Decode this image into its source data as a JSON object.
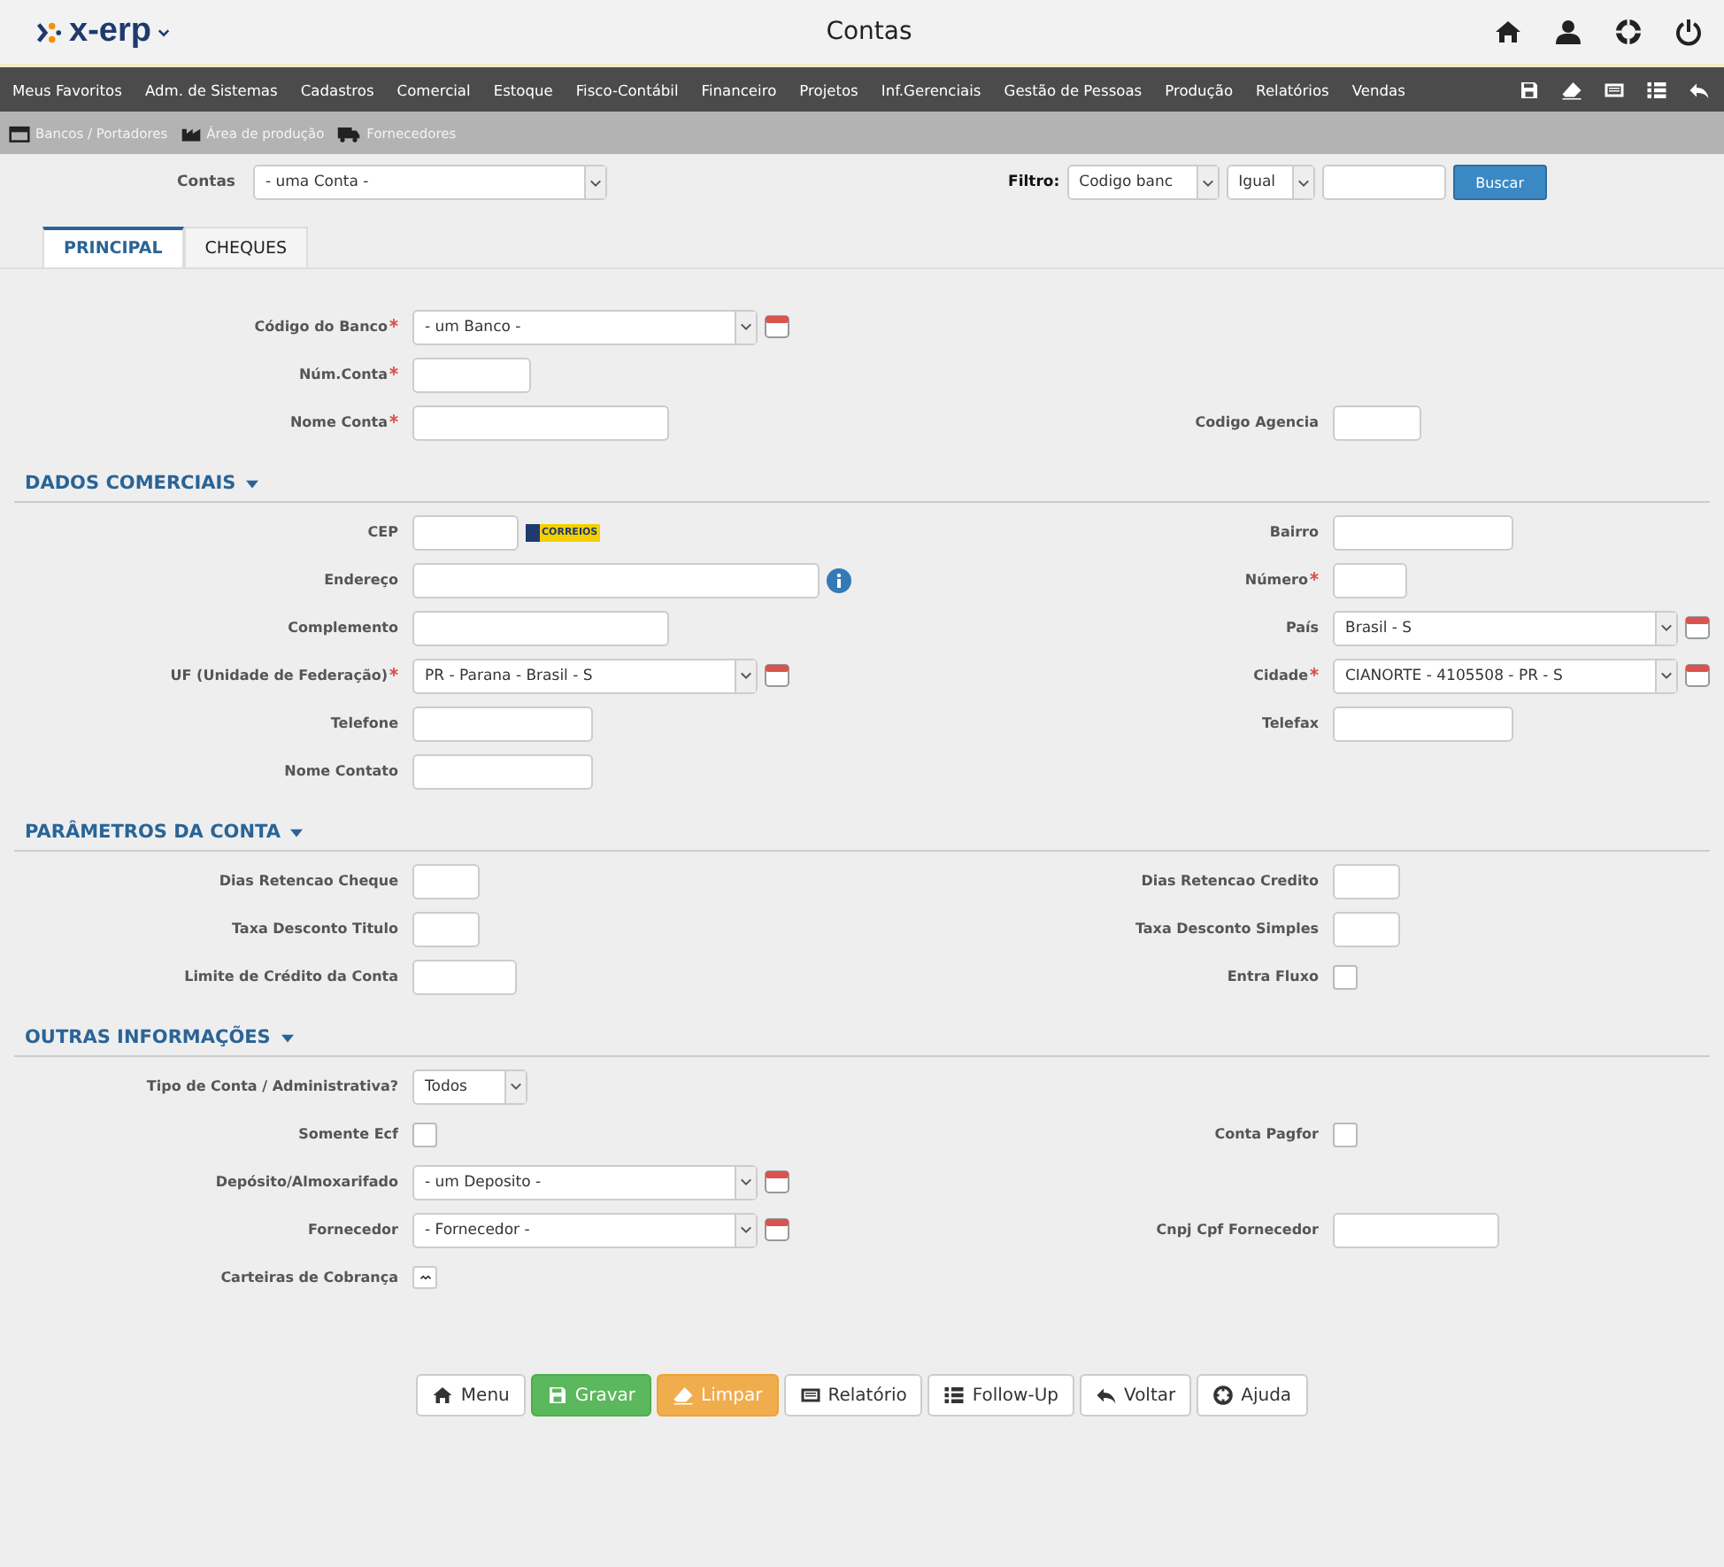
{
  "app": {
    "logo": "x-erp",
    "title": "Contas"
  },
  "menu": [
    "Meus Favoritos",
    "Adm. de Sistemas",
    "Cadastros",
    "Comercial",
    "Estoque",
    "Fisco-Contábil",
    "Financeiro",
    "Projetos",
    "Inf.Gerenciais",
    "Gestão de Pessoas",
    "Produção",
    "Relatórios",
    "Vendas"
  ],
  "breadcrumbs": [
    "Bancos / Portadores",
    "Área de produção",
    "Fornecedores"
  ],
  "search": {
    "label": "Contas",
    "value": "- uma Conta -",
    "filter_label": "Filtro:",
    "filter_field": "Codigo banc",
    "operator": "Igual",
    "button": "Buscar"
  },
  "tabs": [
    {
      "label": "PRINCIPAL",
      "selected": true
    },
    {
      "label": "CHEQUES",
      "selected": false
    }
  ],
  "sections": [
    {
      "rows": [
        {
          "left": {
            "label": "Código do Banco",
            "required": true,
            "kind": "lookup",
            "value": "- um Banco -"
          }
        },
        {
          "left": {
            "label": "Núm.Conta",
            "required": true,
            "kind": "text"
          }
        },
        {
          "left": {
            "label": "Nome Conta",
            "required": true,
            "kind": "text"
          },
          "right": {
            "label": "Codigo Agencia",
            "required": false,
            "kind": "text"
          }
        }
      ]
    },
    {
      "title": "DADOS COMERCIAIS",
      "rows": [
        {
          "left": {
            "label": "CEP",
            "required": false,
            "kind": "cep",
            "logo_text": "CORREIOS"
          },
          "right": {
            "label": "Bairro",
            "required": false,
            "kind": "text"
          }
        },
        {
          "left": {
            "label": "Endereço",
            "required": false,
            "kind": "address"
          },
          "right": {
            "label": "Número",
            "required": true,
            "kind": "text"
          }
        },
        {
          "left": {
            "label": "Complemento",
            "required": false,
            "kind": "text"
          },
          "right": {
            "label": "País",
            "required": false,
            "kind": "lookup",
            "value": "Brasil - S"
          }
        },
        {
          "left": {
            "label": "UF (Unidade de Federação)",
            "required": true,
            "kind": "lookup",
            "value": "PR - Parana - Brasil - S"
          },
          "right": {
            "label": "Cidade",
            "required": true,
            "kind": "lookup",
            "value": "CIANORTE - 4105508 - PR - S"
          }
        },
        {
          "left": {
            "label": "Telefone",
            "required": false,
            "kind": "text"
          },
          "right": {
            "label": "Telefax",
            "required": false,
            "kind": "text"
          }
        },
        {
          "left": {
            "label": "Nome Contato",
            "required": false,
            "kind": "text"
          }
        }
      ]
    },
    {
      "title": "PARÂMETROS DA CONTA",
      "rows": [
        {
          "left": {
            "label": "Dias Retencao Cheque",
            "required": false,
            "kind": "text"
          },
          "right": {
            "label": "Dias Retencao Credito",
            "required": false,
            "kind": "text"
          }
        },
        {
          "left": {
            "label": "Taxa Desconto Titulo",
            "required": false,
            "kind": "text"
          },
          "right": {
            "label": "Taxa Desconto Simples",
            "required": false,
            "kind": "text"
          }
        },
        {
          "left": {
            "label": "Limite de Crédito da Conta",
            "required": false,
            "kind": "text"
          },
          "right": {
            "label": "Entra Fluxo",
            "required": false,
            "kind": "checkbox",
            "checked": false
          }
        }
      ]
    },
    {
      "title": "OUTRAS INFORMAÇÕES",
      "rows": [
        {
          "left": {
            "label": "Tipo de Conta / Administrativa?",
            "required": false,
            "kind": "select",
            "value": "Todos"
          }
        },
        {
          "left": {
            "label": "Somente Ecf",
            "required": false,
            "kind": "checkbox",
            "checked": false
          },
          "right": {
            "label": "Conta Pagfor",
            "required": false,
            "kind": "checkbox",
            "checked": false
          }
        },
        {
          "left": {
            "label": "Depósito/Almoxarifado",
            "required": false,
            "kind": "lookup",
            "value": "- um Deposito -"
          }
        },
        {
          "left": {
            "label": "Fornecedor",
            "required": false,
            "kind": "lookup",
            "value": "- Fornecedor -"
          },
          "right": {
            "label": "Cnpj Cpf Fornecedor",
            "required": false,
            "kind": "text"
          }
        },
        {
          "left": {
            "label": "Carteiras de Cobrança",
            "required": false,
            "kind": "button"
          }
        }
      ]
    }
  ],
  "buttons": [
    "Menu",
    "Gravar",
    "Limpar",
    "Relatório",
    "Follow-Up",
    "Voltar",
    "Ajuda"
  ]
}
